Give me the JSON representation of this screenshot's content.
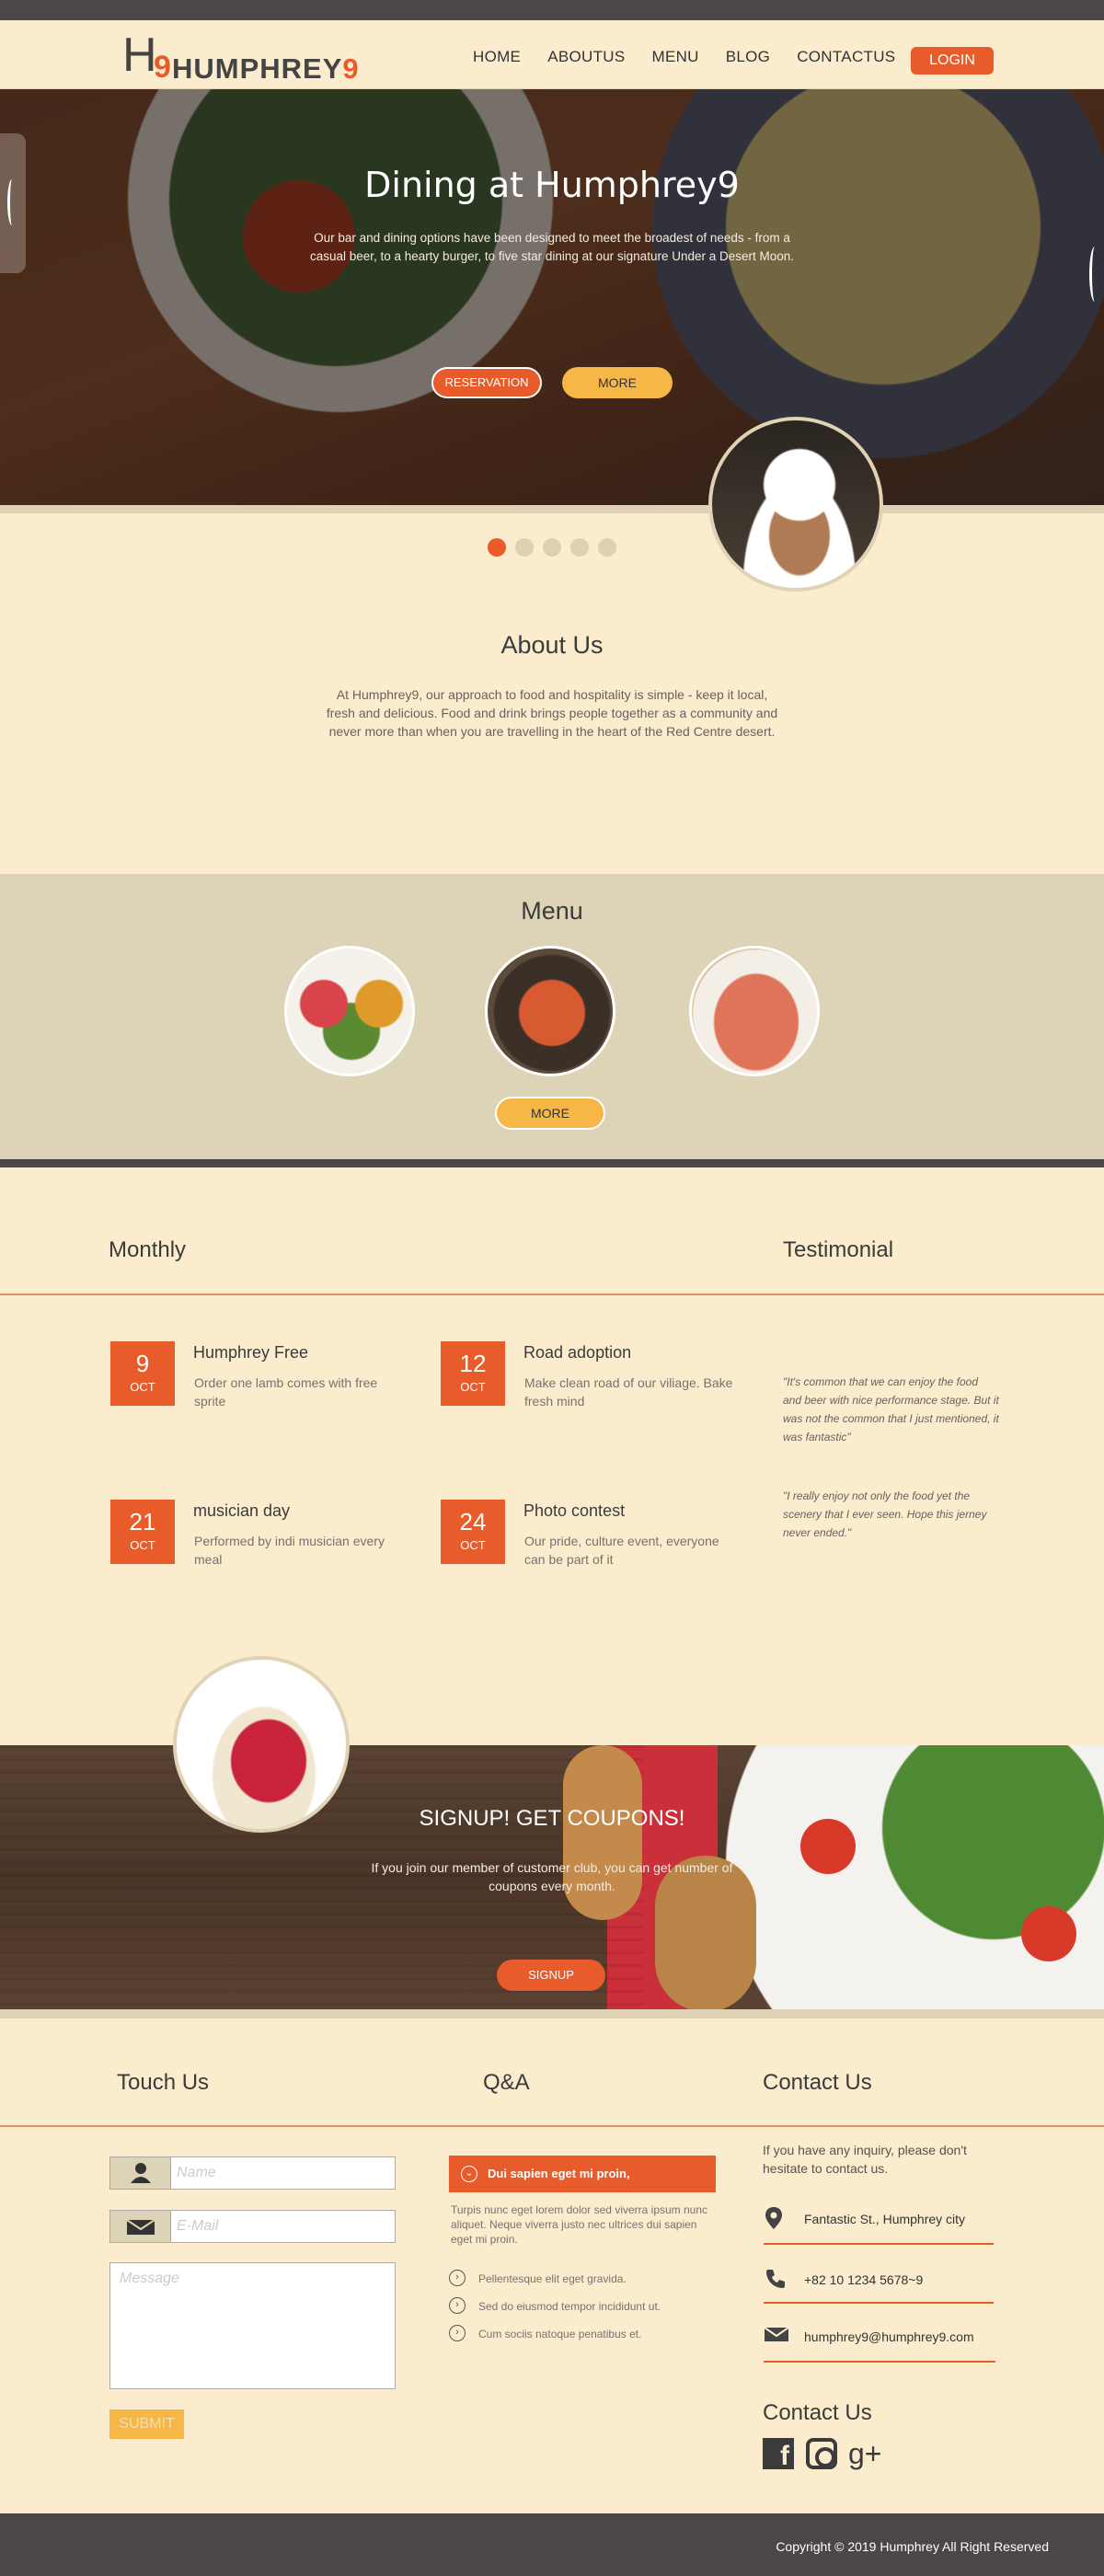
{
  "brand": {
    "logo_h": "H",
    "logo_nine": "9",
    "name_main": "HUMPHREY",
    "name_nine": "9"
  },
  "nav": {
    "items": [
      "HOME",
      "ABOUTUS",
      "MENU",
      "BLOG",
      "CONTACTUS"
    ],
    "login": "LOGIN"
  },
  "hero": {
    "title": "Dining at Humphrey9",
    "subtitle": "Our bar and dining options have been designed to meet the broadest of needs - from a casual beer, to a hearty burger, to five star dining at our signature Under a Desert Moon.",
    "reservation": "RESERVATION",
    "more": "MORE",
    "slide_count": 5,
    "active_slide": 1
  },
  "about": {
    "title": "About Us",
    "text": "At Humphrey9, our approach to food and hospitality is simple - keep it local, fresh and delicious. Food and drink brings people together as a community and never more than when you are travelling in the heart of the Red Centre desert."
  },
  "menu": {
    "title": "Menu",
    "more": "MORE"
  },
  "monthly": {
    "title": "Monthly",
    "events": [
      {
        "day": "9",
        "month": "OCT",
        "title": "Humphrey Free",
        "desc": "Order one lamb comes with free sprite"
      },
      {
        "day": "12",
        "month": "OCT",
        "title": "Road adoption",
        "desc": "Make clean road of our viliage. Bake fresh mind"
      },
      {
        "day": "21",
        "month": "OCT",
        "title": "musician day",
        "desc": "Performed by indi musician every meal"
      },
      {
        "day": "24",
        "month": "OCT",
        "title": "Photo contest",
        "desc": "Our pride, culture event, everyone can be part of it"
      }
    ]
  },
  "testimonial": {
    "title": "Testimonial",
    "quotes": [
      "\"It's common that we can enjoy the food and beer with nice performance stage. But it was not the common that I just mentioned, it was fantastic\"",
      "\"I really enjoy not only the food yet the scenery that I ever seen. Hope this jerney never ended.\""
    ]
  },
  "signup": {
    "title": "SIGNUP! GET COUPONS!",
    "text": "If you join our member of customer club, you can get number of coupons every month.",
    "button": "SIGNUP"
  },
  "touch": {
    "title": "Touch Us",
    "name_placeholder": "Name",
    "email_placeholder": "E-Mail",
    "message_placeholder": "Message",
    "submit": "SUBMIT"
  },
  "qa": {
    "title": "Q&A",
    "open_question": "Dui sapien eget mi proin,",
    "open_answer": "Turpis nunc eget lorem dolor sed viverra ipsum nunc aliquet. Neque viverra justo nec ultrices dui sapien eget mi proin.",
    "questions": [
      "Pellentesque elit eget gravida.",
      "Sed do eiusmod tempor incididunt ut.",
      "Cum sociis natoque penatibus et."
    ]
  },
  "contact": {
    "title": "Contact Us",
    "intro": "If you have any inquiry, please don't hesitate to contact us.",
    "address": "Fantastic St., Humphrey city",
    "phone": "+82 10 1234 5678~9",
    "email": "humphrey9@humphrey9.com",
    "social_title": "Contact Us",
    "social": [
      "facebook-icon",
      "instagram-icon",
      "google-plus-icon"
    ]
  },
  "footer": {
    "copyright": "Copyright © 2019 Humphrey All Right Reserved"
  },
  "colors": {
    "accent": "#e85c2b",
    "yellow": "#f7b746",
    "cream": "#fbecce",
    "dark": "#4a4746"
  }
}
